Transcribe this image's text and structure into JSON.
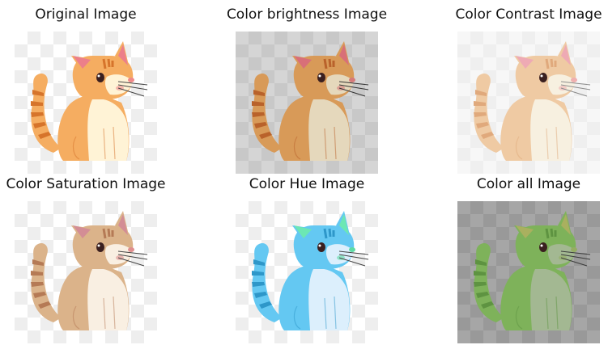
{
  "panels": [
    {
      "title": "Original Image",
      "checker_light": "#ffffff",
      "checker_dark": "#eeeeee",
      "body": "#f5ad61",
      "belly": "#fff3d6",
      "ear": "#ec7f8a",
      "stripe": "#d6742b",
      "nose": "#f08a8a",
      "whisker": "#444444",
      "filter": "none"
    },
    {
      "title": "Color brightness Image",
      "checker_light": "#d5d5d5",
      "checker_dark": "#c8c8c8",
      "body": "#d89a58",
      "belly": "#e5d8bc",
      "ear": "#d86f78",
      "stripe": "#b9622b",
      "nose": "#d67a7a",
      "whisker": "#333333",
      "filter": "none"
    },
    {
      "title": "Color Contrast Image",
      "checker_light": "#f7f7f7",
      "checker_dark": "#efefef",
      "body": "#efcaa3",
      "belly": "#f7f0e0",
      "ear": "#eeaab4",
      "stripe": "#e0a97c",
      "nose": "#f0b0b0",
      "whisker": "#8c8c8c",
      "filter": "none"
    },
    {
      "title": "Color Saturation Image",
      "checker_light": "#ffffff",
      "checker_dark": "#eeeeee",
      "body": "#dbb38a",
      "belly": "#f9efe2",
      "ear": "#d38d95",
      "stripe": "#b57a55",
      "nose": "#e08f8f",
      "whisker": "#444444",
      "filter": "none"
    },
    {
      "title": "Color Hue Image",
      "checker_light": "#ffffff",
      "checker_dark": "#eeeeee",
      "body": "#64c8f2",
      "belly": "#dceffc",
      "ear": "#6ce7b4",
      "stripe": "#2e97c9",
      "nose": "#5edca5",
      "whisker": "#444444",
      "filter": "none"
    },
    {
      "title": "Color all Image",
      "checker_light": "#a6a6a6",
      "checker_dark": "#999999",
      "body": "#7eb25a",
      "belly": "#a3b892",
      "ear": "#a9b05f",
      "stripe": "#5e9341",
      "nose": "#95ad63",
      "whisker": "#3b3b3b",
      "filter": "none"
    }
  ]
}
